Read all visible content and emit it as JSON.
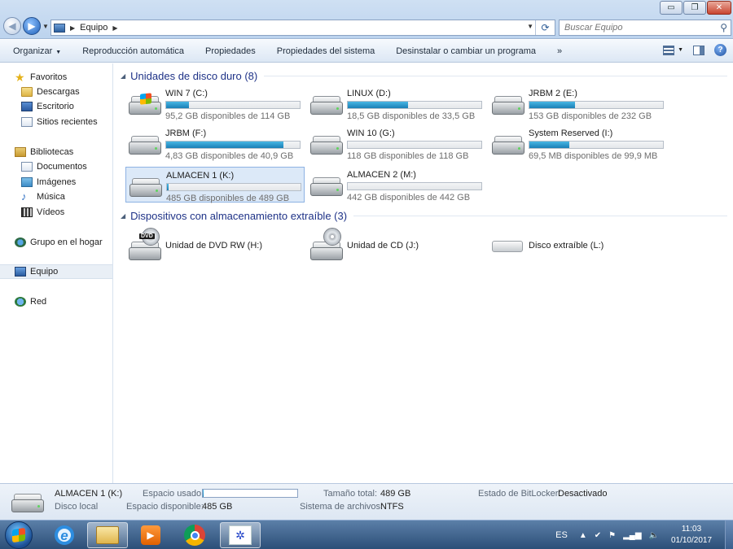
{
  "window": {
    "breadcrumb": "Equipo",
    "search_placeholder": "Buscar Equipo",
    "controls": {
      "minimize": "▭",
      "maximize": "❐",
      "close": "✕"
    }
  },
  "toolbar": {
    "items": [
      {
        "label": "Organizar",
        "has_dropdown": true
      },
      {
        "label": "Reproducción automática"
      },
      {
        "label": "Propiedades"
      },
      {
        "label": "Propiedades del sistema"
      },
      {
        "label": "Desinstalar o cambiar un programa"
      }
    ],
    "more": "»"
  },
  "sidebar": {
    "favorites": {
      "label": "Favoritos",
      "items": [
        "Descargas",
        "Escritorio",
        "Sitios recientes"
      ]
    },
    "libraries": {
      "label": "Bibliotecas",
      "items": [
        "Documentos",
        "Imágenes",
        "Música",
        "Vídeos"
      ]
    },
    "homegroup": "Grupo en el hogar",
    "computer": "Equipo",
    "network": "Red"
  },
  "hard_drives": {
    "title": "Unidades de disco duro (8)",
    "drives": [
      {
        "name": "WIN 7 (C:)",
        "free": "95,2 GB disponibles de 114 GB",
        "used_fraction": 0.17,
        "system": true
      },
      {
        "name": "LINUX (D:)",
        "free": "18,5 GB disponibles de 33,5 GB",
        "used_fraction": 0.45
      },
      {
        "name": "JRBM 2 (E:)",
        "free": "153 GB disponibles de 232 GB",
        "used_fraction": 0.34
      },
      {
        "name": "JRBM (F:)",
        "free": "4,83 GB disponibles de 40,9 GB",
        "used_fraction": 0.88
      },
      {
        "name": "WIN 10 (G:)",
        "free": "118 GB disponibles de 118 GB",
        "used_fraction": 0.0
      },
      {
        "name": "System Reserved (I:)",
        "free": "69,5 MB disponibles de 99,9 MB",
        "used_fraction": 0.3
      },
      {
        "name": "ALMACEN 1 (K:)",
        "free": "485 GB disponibles de 489 GB",
        "used_fraction": 0.01,
        "selected": true
      },
      {
        "name": "ALMACEN 2 (M:)",
        "free": "442 GB disponibles de 442 GB",
        "used_fraction": 0.0
      }
    ]
  },
  "removable": {
    "title": "Dispositivos con almacenamiento extraíble (3)",
    "devices": [
      {
        "name": "Unidad de DVD RW (H:)",
        "icon": "dvd-drive-icon",
        "badge": "DVD"
      },
      {
        "name": "Unidad de CD (J:)",
        "icon": "cd-drive-icon"
      },
      {
        "name": "Disco extraíble (L:)",
        "icon": "removable-disk-icon"
      }
    ]
  },
  "details": {
    "name": "ALMACEN 1 (K:)",
    "type": "Disco local",
    "used_label": "Espacio usado:",
    "used_fraction": 0.01,
    "free_label": "Espacio disponible:",
    "free_value": "485 GB",
    "total_label": "Tamaño total:",
    "total_value": "489 GB",
    "fs_label": "Sistema de archivos:",
    "fs_value": "NTFS",
    "bitlocker_label": "Estado de BitLocker:",
    "bitlocker_value": "Desactivado"
  },
  "taskbar": {
    "language": "ES",
    "time": "11:03",
    "date": "01/10/2017"
  },
  "colors": {
    "group_title": "#1e3287",
    "bar_fill": "#26a0da",
    "selection": "#dce9f8"
  }
}
